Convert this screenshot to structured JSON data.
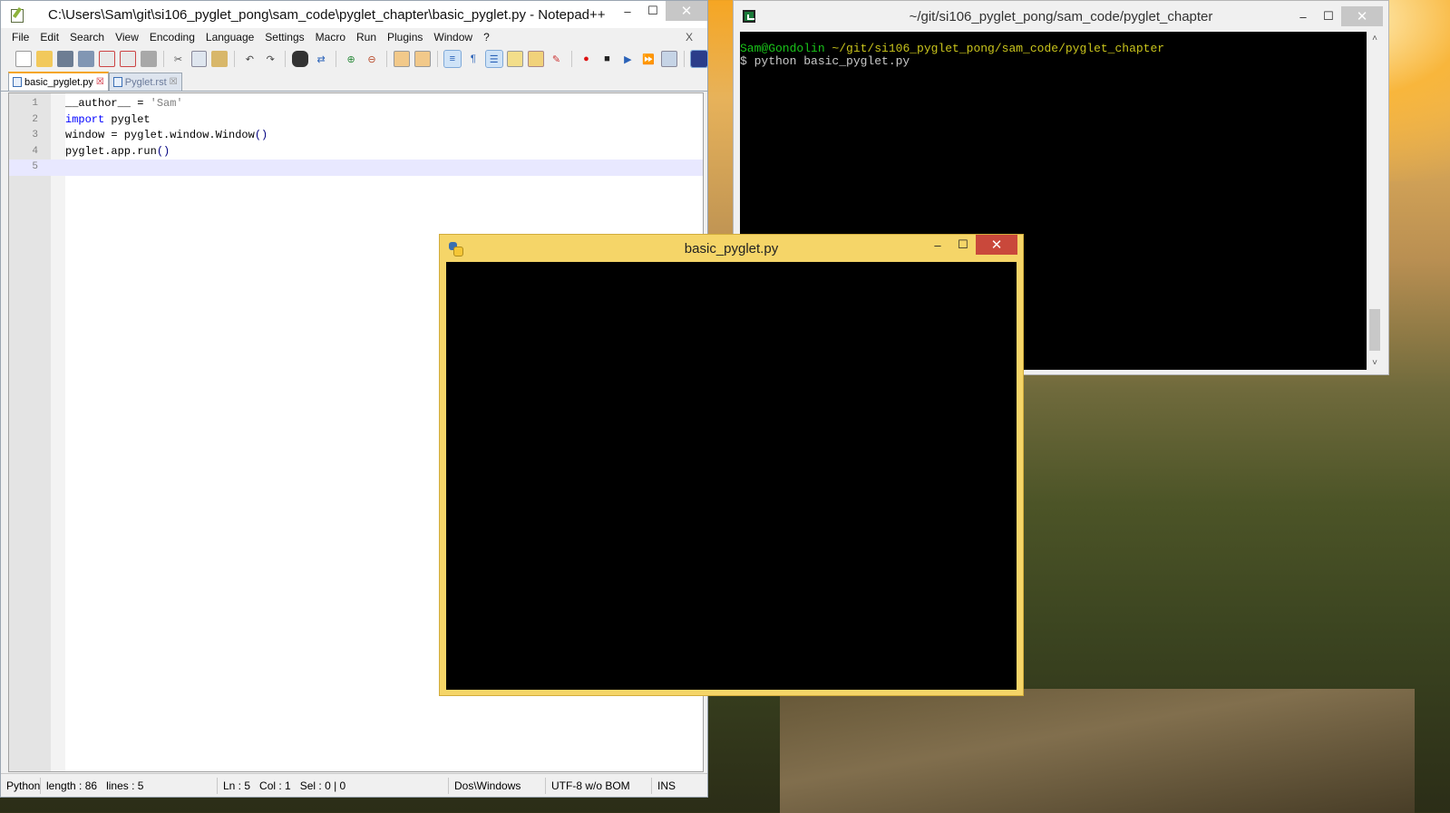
{
  "notepad": {
    "title": "C:\\Users\\Sam\\git\\si106_pyglet_pong\\sam_code\\pyglet_chapter\\basic_pyglet.py - Notepad++",
    "menu": [
      "File",
      "Edit",
      "Search",
      "View",
      "Encoding",
      "Language",
      "Settings",
      "Macro",
      "Run",
      "Plugins",
      "Window",
      "?"
    ],
    "menu_close": "X",
    "controls": {
      "minimize": "–",
      "maximize": "☐",
      "close": "✕"
    },
    "tabs": [
      {
        "label": "basic_pyglet.py",
        "close": "☒"
      },
      {
        "label": "Pyglet.rst",
        "close": "☒"
      }
    ],
    "lines": [
      {
        "num": "1",
        "parts": [
          {
            "t": "__author__ = ",
            "c": ""
          },
          {
            "t": "'Sam'",
            "c": "str"
          }
        ]
      },
      {
        "num": "2",
        "parts": [
          {
            "t": "import",
            "c": "kw"
          },
          {
            "t": " pyglet",
            "c": ""
          }
        ]
      },
      {
        "num": "3",
        "parts": [
          {
            "t": "window = pyglet.window.Window",
            "c": ""
          },
          {
            "t": "()",
            "c": "paren"
          }
        ]
      },
      {
        "num": "4",
        "parts": [
          {
            "t": "pyglet.app.run",
            "c": ""
          },
          {
            "t": "()",
            "c": "paren"
          }
        ]
      },
      {
        "num": "5",
        "parts": []
      }
    ],
    "status": {
      "language": "Python",
      "length": "length : 86",
      "lines": "lines : 5",
      "ln": "Ln : 5",
      "col": "Col : 1",
      "sel": "Sel : 0 | 0",
      "eol": "Dos\\Windows",
      "encoding": "UTF-8 w/o BOM",
      "mode": "INS"
    }
  },
  "terminal": {
    "title": "~/git/si106_pyglet_pong/sam_code/pyglet_chapter",
    "controls": {
      "minimize": "–",
      "maximize": "☐",
      "close": "✕"
    },
    "prompt_user": "Sam@Gondolin",
    "prompt_path": " ~/git/si106_pyglet_pong/sam_code/pyglet_chapter",
    "command": "$ python basic_pyglet.py",
    "scroll_up": "˄",
    "scroll_down": "˅"
  },
  "pyglet_window": {
    "title": "basic_pyglet.py",
    "controls": {
      "minimize": "–",
      "maximize": "☐",
      "close": "✕"
    }
  }
}
